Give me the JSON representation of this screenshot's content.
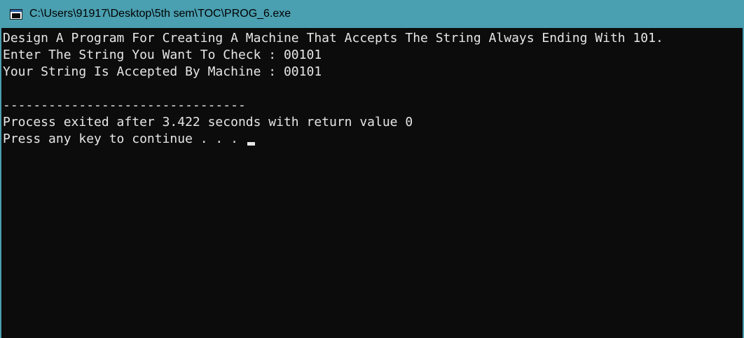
{
  "window": {
    "title": "C:\\Users\\91917\\Desktop\\5th sem\\TOC\\PROG_6.exe",
    "icon": "console-app-icon"
  },
  "console": {
    "lines": [
      "Design A Program For Creating A Machine That Accepts The String Always Ending With 101.",
      "Enter The String You Want To Check : 00101",
      "Your String Is Accepted By Machine : 00101",
      "",
      "--------------------------------",
      "Process exited after 3.422 seconds with return value 0",
      "Press any key to continue . . . "
    ]
  },
  "colors": {
    "titlebar": "#4a9fb0",
    "console_bg": "#0c0c0c",
    "console_text": "#e6e6e6"
  }
}
